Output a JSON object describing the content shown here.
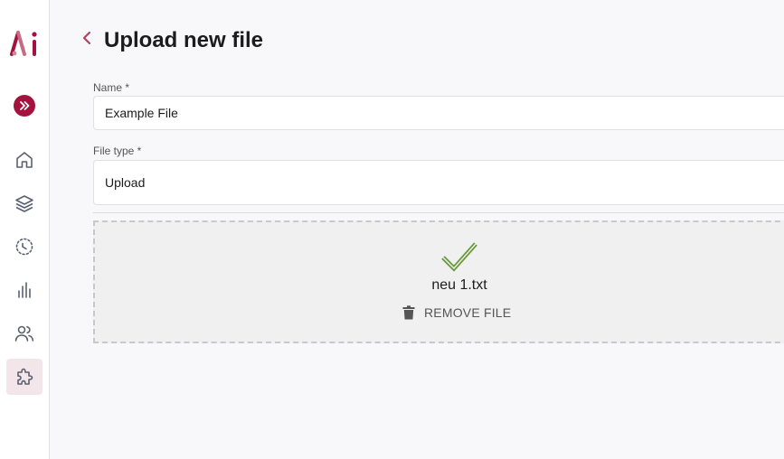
{
  "sidebar": {
    "logo_text": "Ai",
    "items": [
      {
        "icon": "home-icon"
      },
      {
        "icon": "layers-icon"
      },
      {
        "icon": "time-circle-icon"
      },
      {
        "icon": "bar-chart-icon"
      },
      {
        "icon": "users-icon"
      },
      {
        "icon": "puzzle-icon",
        "active": true
      }
    ]
  },
  "header": {
    "title": "Upload new file"
  },
  "form": {
    "name_label": "Name *",
    "name_value": "Example File",
    "file_type_label": "File type *",
    "file_type_value": "Upload"
  },
  "upload": {
    "file_name": "neu 1.txt",
    "remove_label": "REMOVE FILE",
    "status_icon": "check-icon"
  },
  "colors": {
    "brand": "#a2143f",
    "success": "#6a9a3c"
  }
}
